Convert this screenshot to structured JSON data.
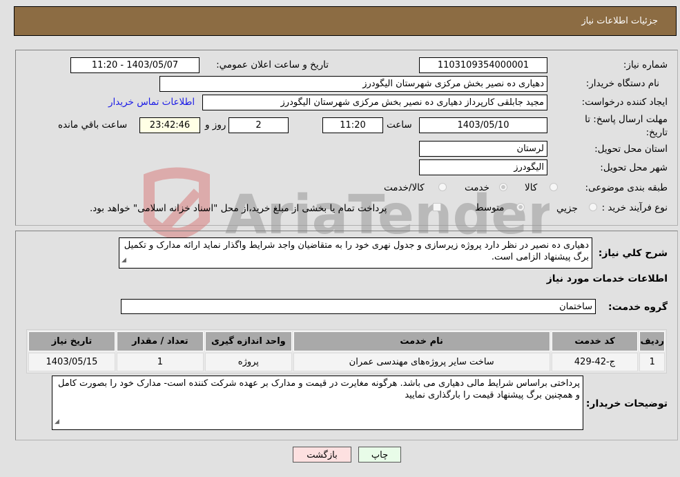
{
  "header": {
    "title": "جزئیات اطلاعات نیاز"
  },
  "form": {
    "need_number": {
      "label": "شماره نیاز:",
      "value": "1103109354000001"
    },
    "announce_datetime": {
      "label": "تاریخ و ساعت اعلان عمومي:",
      "value": "1403/05/07 - 11:20"
    },
    "buyer_org": {
      "label": "نام دستگاه خریدار:",
      "value": "دهیاری ده نصیر بخش مرکزی شهرستان الیگودرز"
    },
    "requester": {
      "label": "ایجاد کننده درخواست:",
      "value": "مجید جابلقی کارپرداز دهیاری ده نصیر بخش مرکزی شهرستان الیگودرز"
    },
    "buyer_contact_link": "اطلاعات تماس خریدار",
    "deadline": {
      "label": "مهلت ارسال پاسخ: تا تاریخ:",
      "date": "1403/05/10",
      "time_label": "ساعت",
      "time": "11:20",
      "days": "2",
      "days_label": "روز و",
      "remaining": "23:42:46",
      "remaining_label": "ساعت باقي مانده"
    },
    "province": {
      "label": "استان محل تحویل:",
      "value": "لرستان"
    },
    "city": {
      "label": "شهر محل تحویل:",
      "value": "الیگودرز"
    },
    "category": {
      "label": "طبقه بندی موضوعی:",
      "options": [
        {
          "label": "کالا",
          "checked": false
        },
        {
          "label": "خدمت",
          "checked": true
        },
        {
          "label": "کالا/خدمت",
          "checked": false
        }
      ]
    },
    "process": {
      "label": "نوع فرآیند خرید :",
      "options": [
        {
          "label": "جزيي",
          "checked": false
        },
        {
          "label": "متوسط",
          "checked": true
        }
      ],
      "treasury_checkbox_label": "پرداخت تمام یا بخشی از مبلغ خرید،از محل \"اسناد خزانه اسلامی\" خواهد بود."
    }
  },
  "details": {
    "general_desc": {
      "label": "شرح کلي نیاز:",
      "value": "دهیاری ده نصیر در نظر دارد پروژه زیرسازی و جدول نهری خود را به متقاضیان واجد شرایط واگذار نماید ارائه مدارک و تکمیل برگ پیشنهاد الزامی است."
    },
    "services_title": "اطلاعات خدمات مورد نیاز",
    "service_group": {
      "label": "گروه خدمت:",
      "value": "ساختمان"
    },
    "table": {
      "headers": [
        "ردیف",
        "کد خدمت",
        "نام خدمت",
        "واحد اندازه گیری",
        "تعداد / مقدار",
        "تاریخ نیاز"
      ],
      "rows": [
        [
          "1",
          "ج-42-429",
          "ساخت سایر پروژه‌های مهندسی عمران",
          "پروژه",
          "1",
          "1403/05/15"
        ]
      ]
    },
    "buyer_notes": {
      "label": "توضیحات خریدار:",
      "value": "پرداختی براساس شرایط مالی دهیاری می باشد. هرگونه مغایرت در قیمت و مدارک بر عهده شرکت کننده است- مدارک خود را بصورت کامل و همچنین برگ پیشنهاد قیمت را بارگذاری نمایید"
    }
  },
  "buttons": {
    "print": "چاپ",
    "back": "بازگشت"
  },
  "watermark": {
    "text": "AriaTender.neT"
  },
  "colors": {
    "header_bg": "#8c6c43",
    "print_bg": "#e8fce8",
    "back_bg": "#fde0e0",
    "link": "#1a1ae6"
  }
}
